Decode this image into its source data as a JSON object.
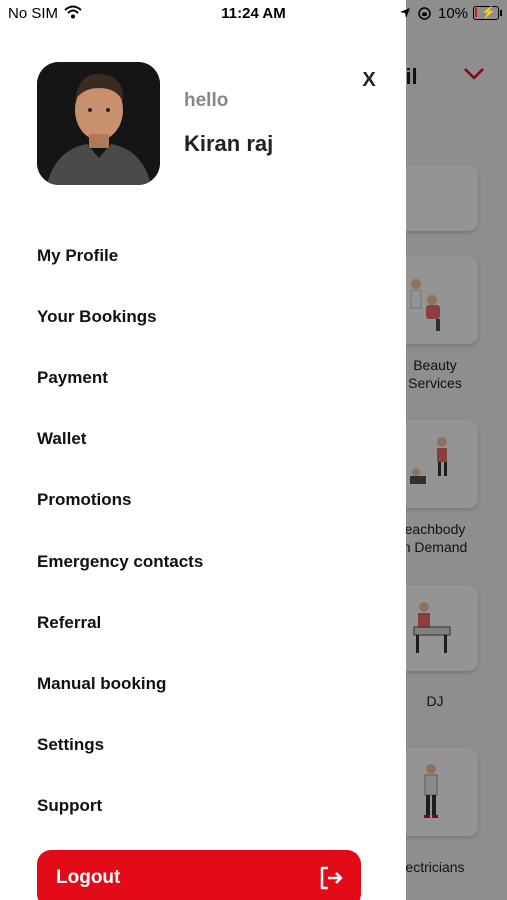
{
  "status_bar": {
    "carrier": "No SIM",
    "time": "11:24 AM",
    "battery_percent": "10%",
    "battery_level": 0.1
  },
  "drawer": {
    "greeting": "hello",
    "user_name": "Kiran raj",
    "close_label": "X",
    "menu_items": [
      "My Profile",
      "Your Bookings",
      "Payment",
      "Wallet",
      "Promotions",
      "Emergency contacts",
      "Referral",
      "Manual booking",
      "Settings",
      "Support"
    ],
    "logout_label": "Logout"
  },
  "background": {
    "header_fragment": "nil",
    "cards": [
      {
        "label_line1": "",
        "label_line2": ""
      },
      {
        "label_line1": "Beauty",
        "label_line2": "Services"
      },
      {
        "label_line1": "eachbody",
        "label_line2": "n Demand"
      },
      {
        "label_line1": "DJ",
        "label_line2": ""
      },
      {
        "label_line1": "ectricians",
        "label_line2": ""
      }
    ]
  },
  "colors": {
    "accent": "#e30b17",
    "text": "#111111",
    "muted": "#888888"
  }
}
